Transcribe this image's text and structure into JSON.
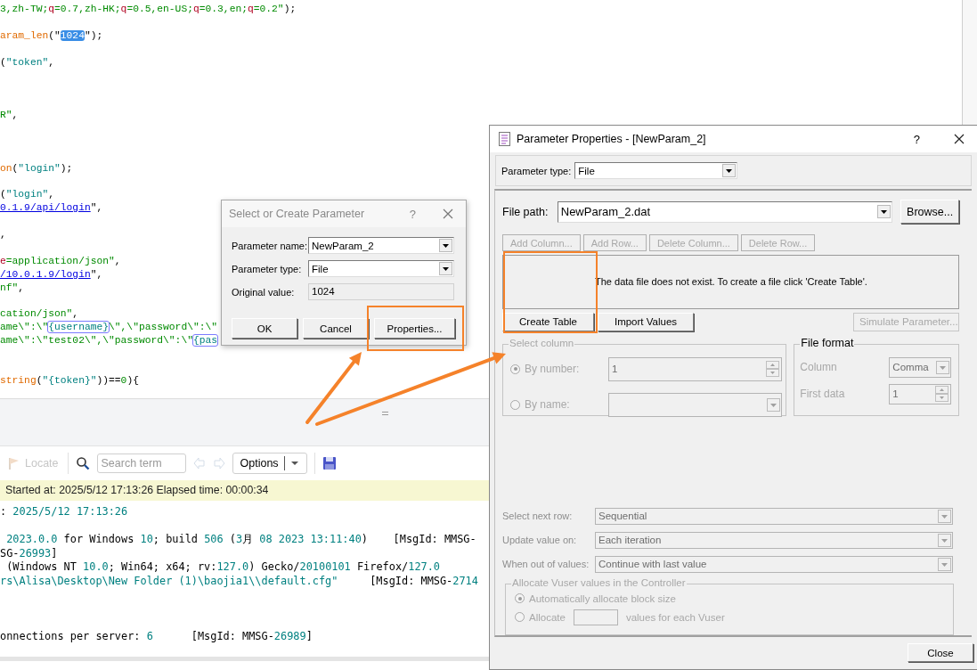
{
  "editor": {
    "lines": [
      {
        "kind": "code",
        "segments": [
          {
            "text": "3,zh-TW;",
            "kind": "str"
          },
          {
            "text": "q",
            "kind": "red"
          },
          {
            "text": "=0.7,zh-HK;",
            "kind": "str"
          },
          {
            "text": "q",
            "kind": "red"
          },
          {
            "text": "=0.5,en-US;",
            "kind": "str"
          },
          {
            "text": "q",
            "kind": "red"
          },
          {
            "text": "=0.3,en;",
            "kind": "str"
          },
          {
            "text": "q",
            "kind": "red"
          },
          {
            "text": "=0.2\"",
            "kind": "str"
          },
          {
            "text": ");",
            "kind": "plain"
          }
        ]
      },
      {
        "kind": "blank"
      },
      {
        "kind": "code",
        "segments": [
          {
            "text": "aram_len",
            "kind": "func"
          },
          {
            "text": "(\"",
            "kind": "plain"
          },
          {
            "text": "1024",
            "kind": "sel"
          },
          {
            "text": "\");",
            "kind": "plain"
          }
        ]
      },
      {
        "kind": "blank"
      },
      {
        "kind": "code",
        "segments": [
          {
            "text": "(",
            "kind": "plain"
          },
          {
            "text": "\"token\"",
            "kind": "teal"
          },
          {
            "text": ",",
            "kind": "plain"
          }
        ]
      },
      {
        "kind": "blank"
      },
      {
        "kind": "blank"
      },
      {
        "kind": "blank"
      },
      {
        "kind": "code",
        "segments": [
          {
            "text": "R\"",
            "kind": "str"
          },
          {
            "text": ",",
            "kind": "plain"
          }
        ]
      },
      {
        "kind": "blank"
      },
      {
        "kind": "blank"
      },
      {
        "kind": "blank"
      },
      {
        "kind": "code",
        "segments": [
          {
            "text": "on",
            "kind": "func"
          },
          {
            "text": "(",
            "kind": "plain"
          },
          {
            "text": "\"login\"",
            "kind": "teal"
          },
          {
            "text": ");",
            "kind": "plain"
          }
        ]
      },
      {
        "kind": "blank"
      },
      {
        "kind": "code",
        "segments": [
          {
            "text": "(",
            "kind": "plain"
          },
          {
            "text": "\"login\"",
            "kind": "teal"
          },
          {
            "text": ",",
            "kind": "plain"
          }
        ]
      },
      {
        "kind": "code",
        "segments": [
          {
            "text": "0.1.9/api/login",
            "kind": "link"
          },
          {
            "text": "\",",
            "kind": "plain"
          }
        ]
      },
      {
        "kind": "blank"
      },
      {
        "kind": "code",
        "segments": [
          {
            "text": ",",
            "kind": "plain"
          }
        ]
      },
      {
        "kind": "blank"
      },
      {
        "kind": "code",
        "segments": [
          {
            "text": "e",
            "kind": "red"
          },
          {
            "text": "=application/json\"",
            "kind": "str"
          },
          {
            "text": ",",
            "kind": "plain"
          }
        ]
      },
      {
        "kind": "code",
        "segments": [
          {
            "text": "/10.0.1.9/login",
            "kind": "link"
          },
          {
            "text": "\",",
            "kind": "plain"
          }
        ]
      },
      {
        "kind": "code",
        "segments": [
          {
            "text": "nf\"",
            "kind": "str"
          },
          {
            "text": ",",
            "kind": "plain"
          }
        ]
      },
      {
        "kind": "blank"
      },
      {
        "kind": "code",
        "segments": [
          {
            "text": "cation/json\"",
            "kind": "str"
          },
          {
            "text": ",",
            "kind": "plain"
          }
        ]
      },
      {
        "kind": "code",
        "segments": [
          {
            "text": "ame\\\":\\\"",
            "kind": "str"
          },
          {
            "text": "{username}",
            "kind": "param"
          },
          {
            "text": "\\\",\\\"password\\\":\\\"",
            "kind": "str"
          }
        ]
      },
      {
        "kind": "code",
        "segments": [
          {
            "text": "ame\\\":\\\"test02\\\",\\\"password\\\":\\\"",
            "kind": "str"
          },
          {
            "text": "{pas",
            "kind": "param"
          }
        ]
      },
      {
        "kind": "blank"
      },
      {
        "kind": "blank"
      },
      {
        "kind": "code",
        "segments": [
          {
            "text": "string",
            "kind": "func"
          },
          {
            "text": "(",
            "kind": "plain"
          },
          {
            "text": "\"{token}\"",
            "kind": "teal"
          },
          {
            "text": "))==",
            "kind": "plain"
          },
          {
            "text": "0",
            "kind": "str"
          },
          {
            "text": "){",
            "kind": "plain"
          }
        ]
      }
    ]
  },
  "log_panel": {
    "toolbar": {
      "locate": {
        "label": "Locate",
        "disabled": true
      },
      "search": {
        "placeholder": "Search term"
      },
      "back": {
        "disabled": true
      },
      "forward": {
        "disabled": true
      },
      "options": "Options"
    },
    "status": "Started at: 2025/5/12 17:13:26 Elapsed time: 00:00:34",
    "lines": [
      {
        "kind": "code",
        "segments": [
          {
            "text": ": ",
            "kind": "plain"
          },
          {
            "text": "2025/5/12 17:13:26",
            "kind": "teal"
          }
        ]
      },
      {
        "kind": "blank"
      },
      {
        "kind": "code",
        "segments": [
          {
            "text": " 2023.0.0",
            "kind": "teal"
          },
          {
            "text": " for Windows ",
            "kind": "plain"
          },
          {
            "text": "10",
            "kind": "teal"
          },
          {
            "text": "; build ",
            "kind": "plain"
          },
          {
            "text": "506",
            "kind": "teal"
          },
          {
            "text": " (",
            "kind": "plain"
          },
          {
            "text": "3",
            "kind": "teal"
          },
          {
            "text": "月 ",
            "kind": "plain"
          },
          {
            "text": "08 2023 13:11:40",
            "kind": "teal"
          },
          {
            "text": ")    [MsgId: MMSG-",
            "kind": "plain"
          }
        ]
      },
      {
        "kind": "code",
        "segments": [
          {
            "text": "SG-",
            "kind": "plain"
          },
          {
            "text": "26993",
            "kind": "teal"
          },
          {
            "text": "]",
            "kind": "plain"
          }
        ]
      },
      {
        "kind": "code",
        "segments": [
          {
            "text": " (Windows NT ",
            "kind": "plain"
          },
          {
            "text": "10.0",
            "kind": "teal"
          },
          {
            "text": "; Win64; x64; rv:",
            "kind": "plain"
          },
          {
            "text": "127.0",
            "kind": "teal"
          },
          {
            "text": ") Gecko/",
            "kind": "plain"
          },
          {
            "text": "20100101",
            "kind": "teal"
          },
          {
            "text": " Firefox/",
            "kind": "plain"
          },
          {
            "text": "127.0",
            "kind": "teal"
          }
        ]
      },
      {
        "kind": "code",
        "segments": [
          {
            "text": "rs\\Alisa\\Desktop\\New Folder (1)\\baojia1\\\\default.cfg\"",
            "kind": "teal"
          },
          {
            "text": "     [MsgId: MMSG-",
            "kind": "plain"
          },
          {
            "text": "2714",
            "kind": "teal"
          }
        ]
      },
      {
        "kind": "blank"
      },
      {
        "kind": "blank"
      },
      {
        "kind": "blank"
      },
      {
        "kind": "code",
        "segments": [
          {
            "text": "onnections per server: ",
            "kind": "plain"
          },
          {
            "text": "6",
            "kind": "teal"
          },
          {
            "text": "      [MsgId: MMSG-",
            "kind": "plain"
          },
          {
            "text": "26989",
            "kind": "teal"
          },
          {
            "text": "]",
            "kind": "plain"
          }
        ]
      }
    ]
  },
  "select_dialog": {
    "title": "Select or Create Parameter",
    "help": "?",
    "fields": [
      {
        "label": "Parameter name:",
        "value": "NewParam_2",
        "kind": "combo"
      },
      {
        "label": "Parameter type:",
        "value": "File",
        "kind": "combo"
      },
      {
        "label": "Original value:",
        "value": "1024",
        "kind": "readonly"
      }
    ],
    "buttons": [
      {
        "label": "OK"
      },
      {
        "label": "Cancel"
      },
      {
        "label": "Properties..."
      }
    ]
  },
  "properties_dialog": {
    "title": "Parameter Properties - [NewParam_2]",
    "help": "?",
    "parameter_type": {
      "label": "Parameter type:",
      "value": "File"
    },
    "file_path": {
      "label": "File path:",
      "value": "NewParam_2.dat"
    },
    "browse": "Browse...",
    "table_buttons": [
      {
        "label": "Add Column...",
        "disabled": true
      },
      {
        "label": "Add Row...",
        "disabled": true
      },
      {
        "label": "Delete Column...",
        "disabled": true
      },
      {
        "label": "Delete Row...",
        "disabled": true
      }
    ],
    "message": "The data file does not exist. To create a file click 'Create Table'.",
    "actions": [
      {
        "label": "Create Table",
        "disabled": false
      },
      {
        "label": "Import Values",
        "disabled": false
      },
      {
        "label": "Simulate Parameter...",
        "disabled": true
      }
    ],
    "select_column": {
      "title": "Select column",
      "disabled": true,
      "options": [
        {
          "label": "By number:",
          "selected": true,
          "kind": "spin",
          "value": "1"
        },
        {
          "label": "By name:",
          "selected": false,
          "kind": "combo"
        }
      ]
    },
    "file_format": {
      "title": "File format",
      "disabled": true,
      "fields": [
        {
          "label": "Column",
          "kind": "combo",
          "value": "Comma"
        },
        {
          "label": "First data",
          "kind": "spin",
          "value": "1"
        }
      ]
    },
    "settings": [
      {
        "label": "Select next row:",
        "value": "Sequential",
        "disabled": true
      },
      {
        "label": "Update value on:",
        "value": "Each iteration",
        "disabled": true
      },
      {
        "label": "When out of values:",
        "value": "Continue with last value",
        "disabled": true
      }
    ],
    "allocate": {
      "title": "Allocate Vuser values in the Controller",
      "disabled": true,
      "options": [
        {
          "label": "Automatically allocate block size",
          "selected": true,
          "kind": "plain"
        },
        {
          "label": "Allocate",
          "selected": false,
          "kind": "amount",
          "suffix": "values for each Vuser"
        }
      ]
    },
    "close": "Close"
  }
}
